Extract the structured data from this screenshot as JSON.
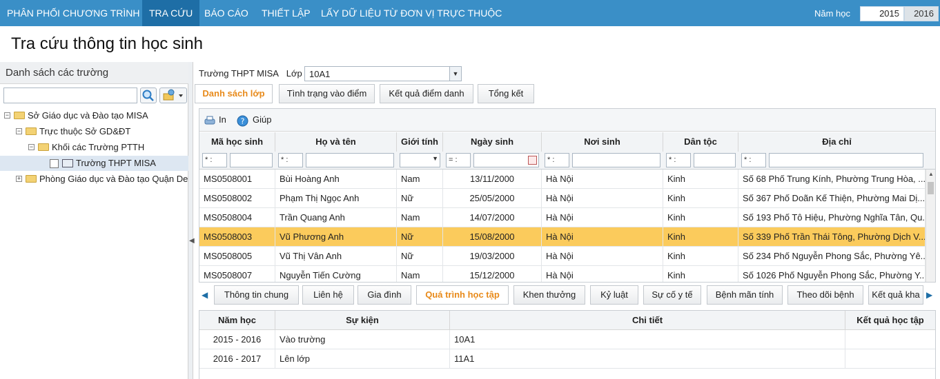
{
  "nav": {
    "items": [
      "PHÂN PHỐI CHƯƠNG TRÌNH",
      "TRA CỨU",
      "BÁO CÁO",
      "THIẾT LẬP",
      "LẤY DỮ LIỆU TỪ ĐƠN VỊ TRỰC THUỘC"
    ],
    "active_index": 1,
    "year_label": "Năm học",
    "year_from": "2015",
    "year_sep": "-",
    "year_to": "2016"
  },
  "page_title": "Tra cứu thông tin học sinh",
  "left": {
    "header": "Danh sách các trường",
    "search_value": "",
    "tree": [
      {
        "label": "Sở Giáo dục và Đào tạo MISA",
        "expander": "−"
      },
      {
        "label": "Trực thuộc Sở GD&ĐT",
        "expander": "−"
      },
      {
        "label": "Khối các Trường PTTH",
        "expander": "−"
      },
      {
        "label": "Trường THPT MISA",
        "expander": ""
      },
      {
        "label": "Phòng Giáo dục và Đào tạo Quận Dem",
        "expander": "+"
      }
    ]
  },
  "filter": {
    "school": "Trường THPT MISA",
    "class_label": "Lớp",
    "class_value": "10A1"
  },
  "tabs": [
    "Danh sách lớp",
    "Tình trạng vào điểm",
    "Kết quả điểm danh",
    "Tổng kết"
  ],
  "toolbar": {
    "print": "In",
    "help": "Giúp"
  },
  "grid": {
    "columns": [
      "Mã học sinh",
      "Họ và tên",
      "Giới tính",
      "Ngày sinh",
      "Nơi sinh",
      "Dân tộc",
      "Địa chỉ"
    ],
    "filter_ops": [
      "* :",
      "* :",
      "",
      "= :",
      "* :",
      "* :",
      "* :"
    ],
    "rows": [
      [
        "MS0508001",
        "Bùi Hoàng Anh",
        "Nam",
        "13/11/2000",
        "Hà Nội",
        "Kinh",
        "Số 68 Phố Trung Kính, Phường Trung Hòa, ..."
      ],
      [
        "MS0508002",
        "Phạm Thị Ngọc Anh",
        "Nữ",
        "25/05/2000",
        "Hà Nội",
        "Kinh",
        "Số 367 Phố Doãn Kế Thiện, Phường Mai Dị..."
      ],
      [
        "MS0508004",
        "Trần Quang Anh",
        "Nam",
        "14/07/2000",
        "Hà Nội",
        "Kinh",
        "Số 193 Phố Tô Hiệu, Phường Nghĩa Tân, Qu..."
      ],
      [
        "MS0508003",
        "Vũ Phương Anh",
        "Nữ",
        "15/08/2000",
        "Hà Nội",
        "Kinh",
        "Số 339 Phố Trần Thái Tông, Phường Dịch V..."
      ],
      [
        "MS0508005",
        "Vũ Thị Vân Anh",
        "Nữ",
        "19/03/2000",
        "Hà Nội",
        "Kinh",
        "Số 234 Phố Nguyễn Phong Sắc, Phường Yê..."
      ],
      [
        "MS0508007",
        "Nguyễn Tiến Cường",
        "Nam",
        "15/12/2000",
        "Hà Nội",
        "Kinh",
        "Số 1026 Phố Nguyễn Phong Sắc, Phường Y..."
      ]
    ],
    "selected_index": 3
  },
  "subtabs": [
    "Thông tin chung",
    "Liên hệ",
    "Gia đình",
    "Quá trình học tập",
    "Khen thưởng",
    "Kỷ luật",
    "Sự cố y tế",
    "Bệnh mãn tính",
    "Theo dõi bệnh",
    "Kết quả kha"
  ],
  "subtab_active": 3,
  "history": {
    "columns": [
      "Năm học",
      "Sự kiện",
      "Chi tiết",
      "Kết quả học tập"
    ],
    "rows": [
      [
        "2015 - 2016",
        "Vào trường",
        "10A1",
        ""
      ],
      [
        "2016 - 2017",
        "Lên lớp",
        "11A1",
        ""
      ]
    ]
  },
  "colors": {
    "nav_bg": "#3a8fc7",
    "nav_active": "#1e6ea6",
    "selected_row": "#fbcb5c",
    "active_tab_text": "#e88a1a"
  }
}
